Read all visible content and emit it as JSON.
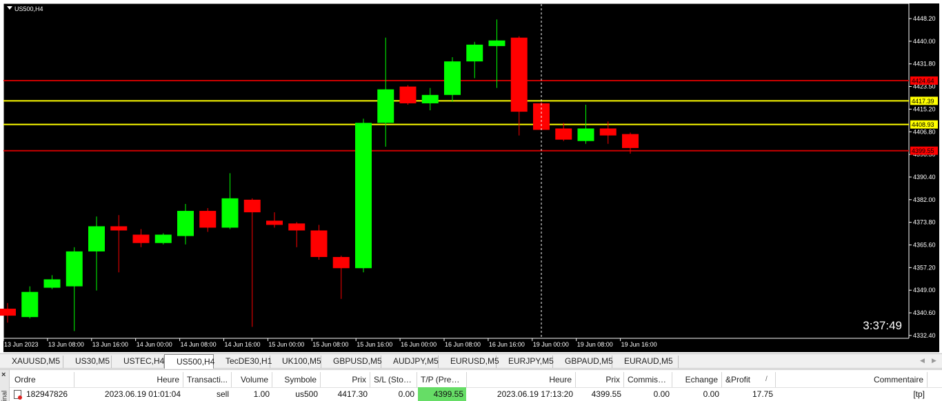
{
  "chart": {
    "symbol_label": "US500,H4",
    "countdown": "3:37:49",
    "background": "#000000",
    "bull_color": "#00ff00",
    "bear_color": "#ff0000",
    "grid_color": "#ffffff",
    "y_ticks": [
      "4448.20",
      "4440.00",
      "4431.80",
      "4423.50",
      "4415.20",
      "4406.80",
      "4398.50",
      "4390.40",
      "4382.00",
      "4373.80",
      "4365.60",
      "4357.20",
      "4349.00",
      "4340.60",
      "4332.40"
    ],
    "x_ticks": [
      "13 Jun 2023",
      "13 Jun 08:00",
      "13 Jun 16:00",
      "14 Jun 00:00",
      "14 Jun 08:00",
      "14 Jun 16:00",
      "15 Jun 00:00",
      "15 Jun 08:00",
      "15 Jun 16:00",
      "16 Jun 00:00",
      "16 Jun 08:00",
      "16 Jun 16:00",
      "19 Jun 00:00",
      "19 Jun 08:00",
      "19 Jun 16:00"
    ],
    "levels": [
      {
        "value": 4424.64,
        "label": "4424.64",
        "color": "#cc0000",
        "label_bg": "#ff0000",
        "label_fg": "#000000"
      },
      {
        "value": 4417.39,
        "label": "4417.39",
        "color": "#ffff00",
        "label_bg": "#ffff00",
        "label_fg": "#000000"
      },
      {
        "value": 4408.93,
        "label": "4408.93",
        "color": "#ffff00",
        "label_bg": "#ffff00",
        "label_fg": "#000000"
      },
      {
        "value": 4399.55,
        "label": "4399.55",
        "color": "#cc0000",
        "label_bg": "#ff0000",
        "label_fg": "#000000"
      }
    ],
    "vline_index": 24
  },
  "chart_data": {
    "type": "candlestick",
    "ylim": [
      4332.4,
      4452.0
    ],
    "candles": [
      {
        "o": 4343.0,
        "h": 4345.0,
        "l": 4338.0,
        "c": 4340.5
      },
      {
        "o": 4340.0,
        "h": 4351.0,
        "l": 4339.5,
        "c": 4349.0
      },
      {
        "o": 4350.5,
        "h": 4355.0,
        "l": 4350.0,
        "c": 4353.5
      },
      {
        "o": 4351.0,
        "h": 4365.0,
        "l": 4335.0,
        "c": 4363.5
      },
      {
        "o": 4363.5,
        "h": 4376.0,
        "l": 4349.5,
        "c": 4372.5
      },
      {
        "o": 4372.5,
        "h": 4376.5,
        "l": 4356.0,
        "c": 4371.0
      },
      {
        "o": 4369.5,
        "h": 4371.5,
        "l": 4365.0,
        "c": 4366.5
      },
      {
        "o": 4366.5,
        "h": 4370.0,
        "l": 4366.0,
        "c": 4369.5
      },
      {
        "o": 4369.0,
        "h": 4380.5,
        "l": 4366.0,
        "c": 4378.0
      },
      {
        "o": 4378.0,
        "h": 4379.0,
        "l": 4370.5,
        "c": 4372.0
      },
      {
        "o": 4372.0,
        "h": 4391.5,
        "l": 4371.5,
        "c": 4382.5
      },
      {
        "o": 4382.0,
        "h": 4382.5,
        "l": 4336.5,
        "c": 4377.5
      },
      {
        "o": 4374.5,
        "h": 4377.5,
        "l": 4372.0,
        "c": 4373.0
      },
      {
        "o": 4373.5,
        "h": 4374.0,
        "l": 4365.0,
        "c": 4371.0
      },
      {
        "o": 4371.0,
        "h": 4373.0,
        "l": 4360.5,
        "c": 4361.5
      },
      {
        "o": 4361.5,
        "h": 4362.0,
        "l": 4346.5,
        "c": 4357.5
      },
      {
        "o": 4357.5,
        "h": 4411.0,
        "l": 4356.0,
        "c": 4409.5
      },
      {
        "o": 4409.5,
        "h": 4440.0,
        "l": 4401.0,
        "c": 4421.5
      },
      {
        "o": 4422.5,
        "h": 4423.0,
        "l": 4416.0,
        "c": 4416.5
      },
      {
        "o": 4416.5,
        "h": 4422.0,
        "l": 4414.0,
        "c": 4419.5
      },
      {
        "o": 4419.5,
        "h": 4433.0,
        "l": 4417.0,
        "c": 4431.5
      },
      {
        "o": 4431.5,
        "h": 4438.5,
        "l": 4425.5,
        "c": 4437.5
      },
      {
        "o": 4437.0,
        "h": 4446.5,
        "l": 4422.0,
        "c": 4439.0
      },
      {
        "o": 4440.0,
        "h": 4440.5,
        "l": 4405.0,
        "c": 4413.5
      },
      {
        "o": 4416.5,
        "h": 4417.0,
        "l": 4407.0,
        "c": 4407.0
      },
      {
        "o": 4407.5,
        "h": 4409.5,
        "l": 4403.0,
        "c": 4403.5
      },
      {
        "o": 4403.0,
        "h": 4416.0,
        "l": 4402.0,
        "c": 4407.5
      },
      {
        "o": 4407.5,
        "h": 4410.0,
        "l": 4402.0,
        "c": 4405.0
      },
      {
        "o": 4405.5,
        "h": 4406.0,
        "l": 4398.5,
        "c": 4400.5
      }
    ]
  },
  "tabs": {
    "items": [
      "XAUUSD,M5",
      "US30,M5",
      "USTEC,H4",
      "US500,H4",
      "TecDE30,H1",
      "UK100,M5",
      "GBPUSD,M5",
      "AUDJPY,M5",
      "EURUSD,M5",
      "EURJPY,M5",
      "GBPAUD,M5",
      "EURAUD,M5"
    ],
    "active_index": 3
  },
  "terminal": {
    "close_glyph": "×",
    "side_label": "inal",
    "headers": [
      "Ordre",
      "Heure",
      "Transacti...",
      "Volume",
      "Symbole",
      "Prix",
      "S/L (Stop...",
      "T/P (Pren...",
      "Heure",
      "Prix",
      "Commiss...",
      "Echange",
      "&Profit",
      "Commentaire"
    ],
    "sort_glyph": "/",
    "row": {
      "order": "182947826",
      "time_open": "2023.06.19 01:01:04",
      "type": "sell",
      "volume": "1.00",
      "symbol": "us500",
      "price_open": "4417.30",
      "sl": "0.00",
      "tp": "4399.55",
      "time_close": "2023.06.19 17:13:20",
      "price_close": "4399.55",
      "commission": "0.00",
      "swap": "0.00",
      "profit": "17.75",
      "comment": "[tp]"
    },
    "tp_highlight": "#66dd66"
  }
}
